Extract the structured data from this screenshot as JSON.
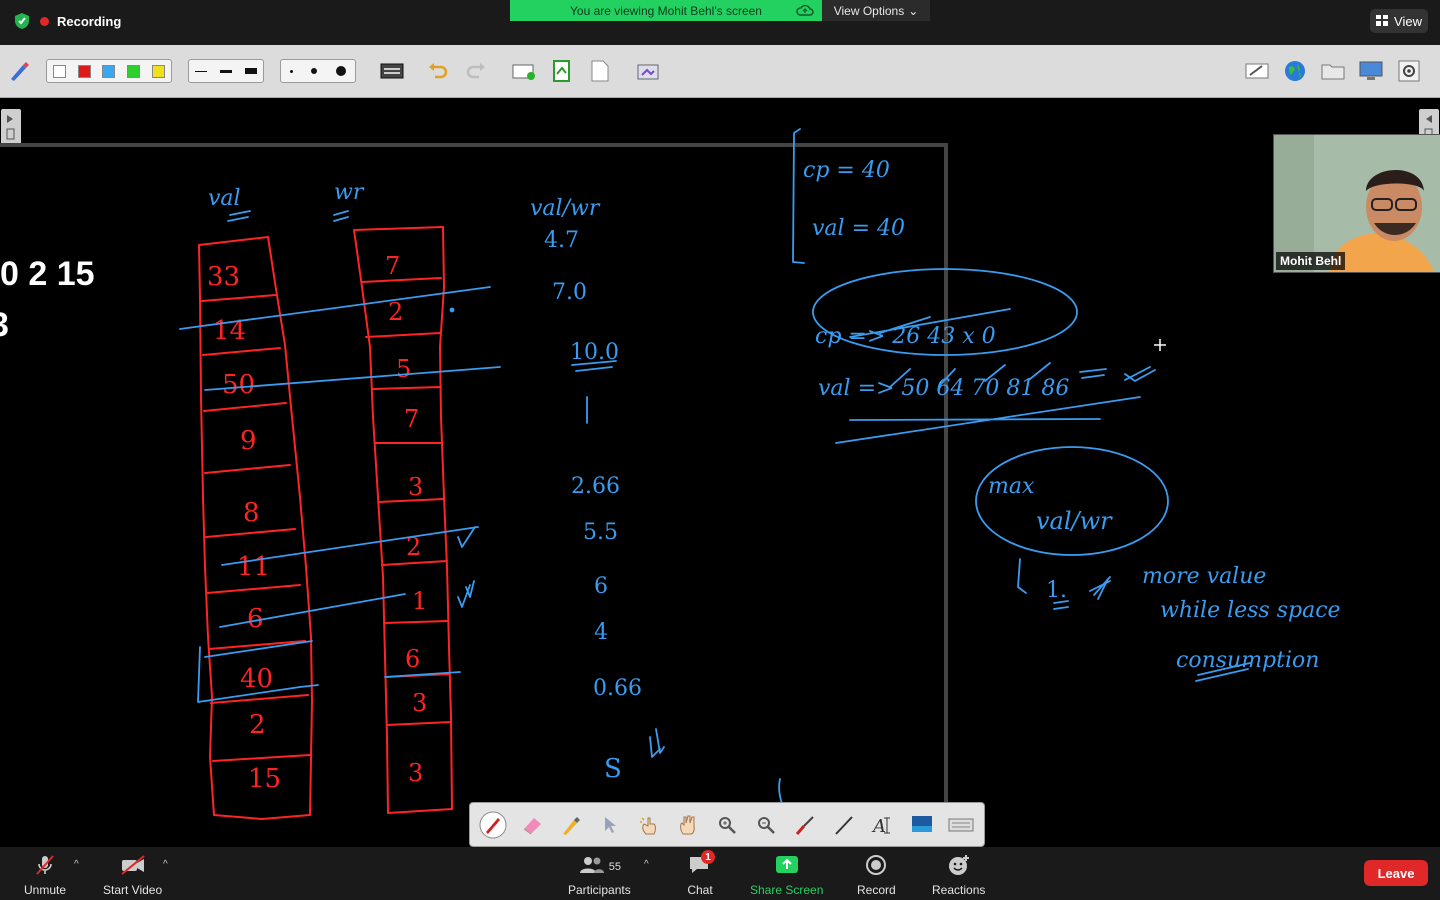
{
  "top": {
    "recording_label": "Recording",
    "banner_text": "You are viewing Mohit Behl's screen",
    "view_options_label": "View Options",
    "view_label": "View"
  },
  "board": {
    "left_text_line1": "0 2 15",
    "left_text_line2": "3",
    "pen_color": "#ff2020",
    "ink_color": "#3a9cf0"
  },
  "video": {
    "participant_name": "Mohit Behl"
  },
  "bottom": {
    "unmute_label": "Unmute",
    "start_video_label": "Start Video",
    "participants_label": "Participants",
    "participants_count": "55",
    "chat_label": "Chat",
    "chat_badge": "1",
    "share_label": "Share Screen",
    "record_label": "Record",
    "reactions_label": "Reactions",
    "leave_label": "Leave"
  },
  "colors": {
    "share_green": "#23d160",
    "leave_red": "#e02828",
    "accent_blue": "#3a9cf0"
  }
}
